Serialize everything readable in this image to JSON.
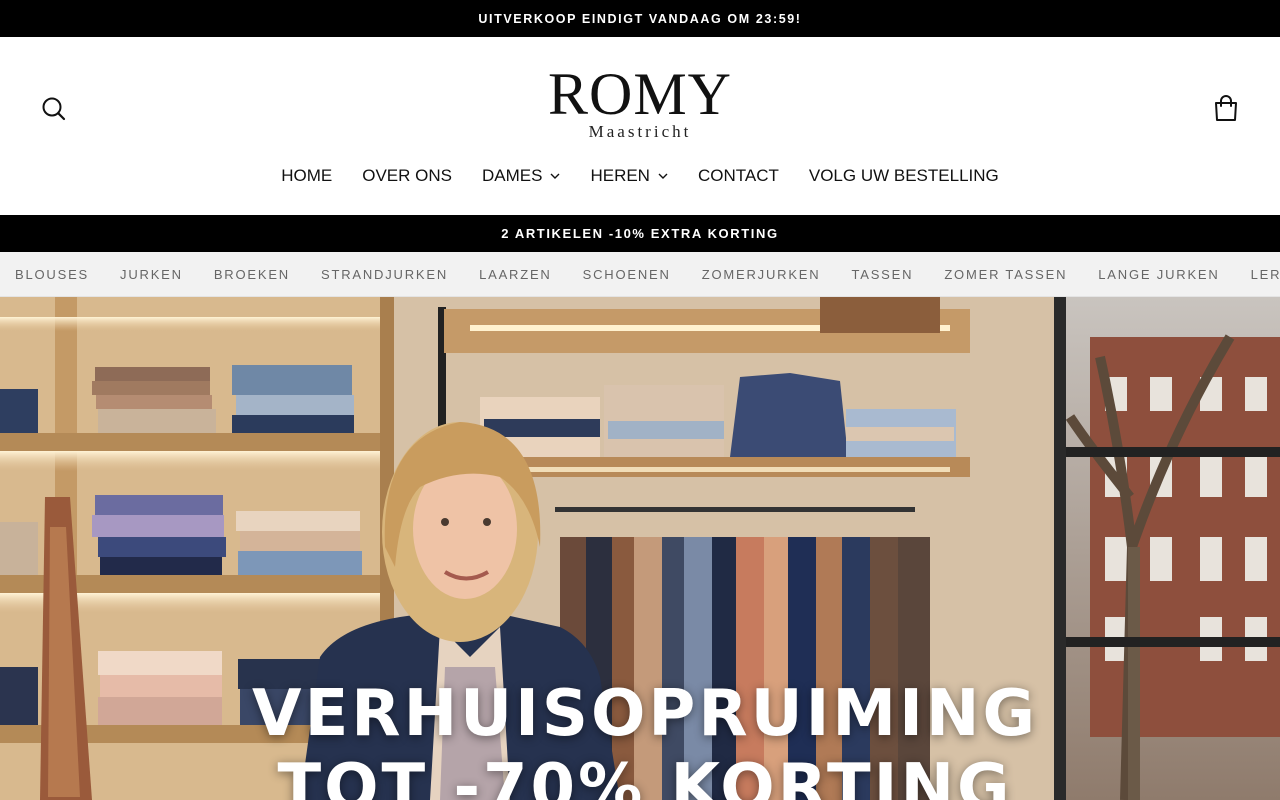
{
  "announcement_top": "UITVERKOOP EINDIGT VANDAAG OM 23:59!",
  "header": {
    "logo_main": "ROMY",
    "logo_sub": "Maastricht",
    "search_icon": "search-icon",
    "cart_icon": "shopping-bag-icon"
  },
  "nav": [
    {
      "label": "HOME",
      "has_dropdown": false
    },
    {
      "label": "OVER ONS",
      "has_dropdown": false
    },
    {
      "label": "DAMES",
      "has_dropdown": true
    },
    {
      "label": "HEREN",
      "has_dropdown": true
    },
    {
      "label": "CONTACT",
      "has_dropdown": false
    },
    {
      "label": "VOLG UW BESTELLING",
      "has_dropdown": false
    }
  ],
  "announcement_mid": "2 ARTIKELEN -10% EXTRA KORTING",
  "categories": [
    "BLOUSES",
    "JURKEN",
    "BROEKEN",
    "STRANDJURKEN",
    "LAARZEN",
    "SCHOENEN",
    "ZOMERJURKEN",
    "TASSEN",
    "ZOMER TASSEN",
    "LANGE JURKEN",
    "LEREN S"
  ],
  "hero": {
    "title_line1": "VERHUISOPRUIMING",
    "title_line2": "TOT -70% KORTING"
  },
  "colors": {
    "black_bar": "#000000",
    "category_bar": "#f2f2f2",
    "hero_text": "#ffffff"
  }
}
